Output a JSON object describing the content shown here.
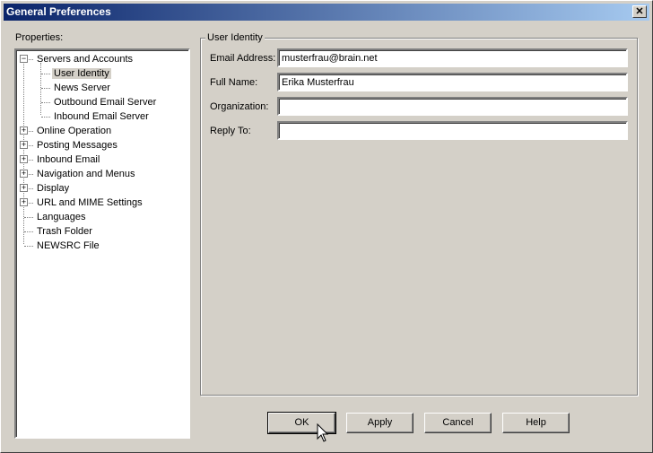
{
  "window": {
    "title": "General Preferences",
    "close_icon": "close-icon"
  },
  "properties_label": "Properties:",
  "tree": [
    {
      "label": "Servers and Accounts",
      "level": 0,
      "expander": "minus"
    },
    {
      "label": "User Identity",
      "level": 1,
      "selected": true
    },
    {
      "label": "News Server",
      "level": 1
    },
    {
      "label": "Outbound Email Server",
      "level": 1
    },
    {
      "label": "Inbound Email Server",
      "level": 1
    },
    {
      "label": "Online Operation",
      "level": 0,
      "expander": "plus"
    },
    {
      "label": "Posting Messages",
      "level": 0,
      "expander": "plus"
    },
    {
      "label": "Inbound Email",
      "level": 0,
      "expander": "plus"
    },
    {
      "label": "Navigation and Menus",
      "level": 0,
      "expander": "plus"
    },
    {
      "label": "Display",
      "level": 0,
      "expander": "plus"
    },
    {
      "label": "URL and MIME Settings",
      "level": 0,
      "expander": "plus"
    },
    {
      "label": "Languages",
      "level": 0
    },
    {
      "label": "Trash Folder",
      "level": 0
    },
    {
      "label": "NEWSRC File",
      "level": 0
    }
  ],
  "group": {
    "title": "User Identity",
    "fields": [
      {
        "label": "Email Address:",
        "value": "musterfrau@brain.net"
      },
      {
        "label": "Full Name:",
        "value": "Erika Musterfrau"
      },
      {
        "label": "Organization:",
        "value": ""
      },
      {
        "label": "Reply To:",
        "value": ""
      }
    ]
  },
  "buttons": {
    "ok": "OK",
    "apply": "Apply",
    "cancel": "Cancel",
    "help": "Help"
  }
}
